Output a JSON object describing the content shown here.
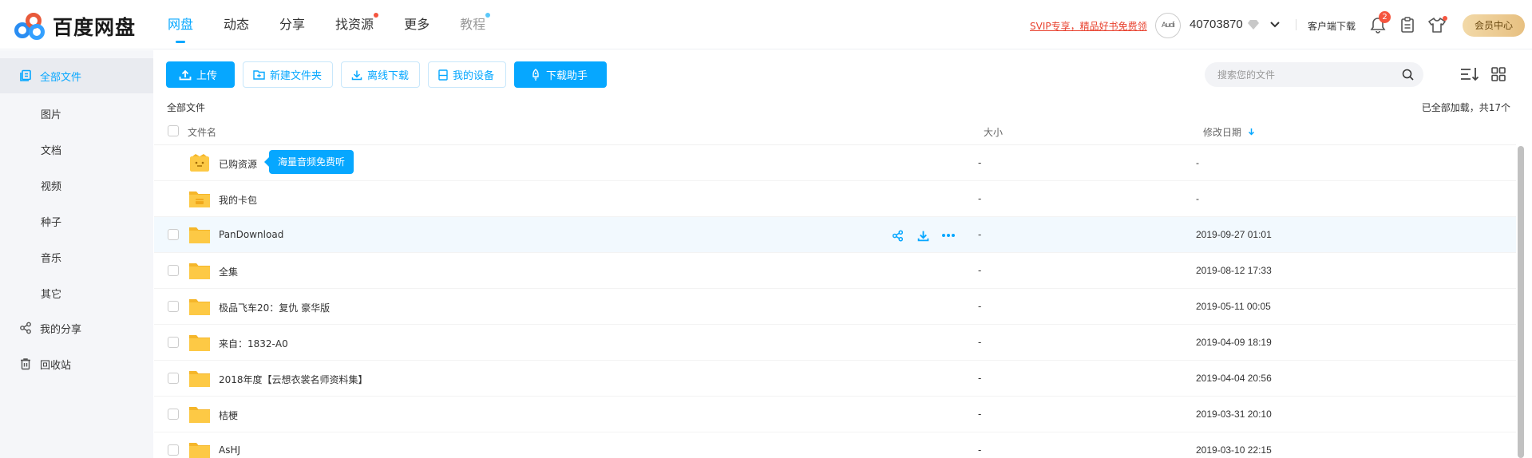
{
  "brand": {
    "name": "百度网盘"
  },
  "nav": [
    {
      "label": "网盘",
      "active": true,
      "dot": ""
    },
    {
      "label": "动态",
      "active": false,
      "dot": ""
    },
    {
      "label": "分享",
      "active": false,
      "dot": ""
    },
    {
      "label": "找资源",
      "active": false,
      "dot": "red"
    },
    {
      "label": "更多",
      "active": false,
      "dot": ""
    },
    {
      "label": "教程",
      "active": false,
      "dot": "blue"
    }
  ],
  "header": {
    "svip_promo": "SVIP专享，精品好书免费领",
    "avatar_text": "Audi",
    "username": "40703870",
    "client_download": "客户端下载",
    "notification_count": "2",
    "vip_center": "会员中心"
  },
  "sidebar": {
    "all_files": "全部文件",
    "categories": [
      "图片",
      "文档",
      "视频",
      "种子",
      "音乐",
      "其它"
    ],
    "my_share": "我的分享",
    "recycle": "回收站"
  },
  "toolbar": {
    "upload": "上传",
    "new_folder": "新建文件夹",
    "offline_download": "离线下载",
    "my_devices": "我的设备",
    "download_helper": "下载助手"
  },
  "search": {
    "placeholder": "搜索您的文件"
  },
  "breadcrumb": "全部文件",
  "loaded_info": "已全部加载，共17个",
  "table": {
    "col_name": "文件名",
    "col_size": "大小",
    "col_date": "修改日期",
    "rows": [
      {
        "name": "已购资源",
        "size": "-",
        "date": "-",
        "icon": "purchased-folder-icon"
      },
      {
        "name": "我的卡包",
        "size": "-",
        "date": "-",
        "icon": "card-folder-icon"
      },
      {
        "name": "PanDownload",
        "size": "-",
        "date": "2019-09-27 01:01",
        "icon": "folder-icon"
      },
      {
        "name": "全集",
        "size": "-",
        "date": "2019-08-12 17:33",
        "icon": "folder-icon"
      },
      {
        "name": "极品飞车20：复仇 豪华版",
        "size": "-",
        "date": "2019-05-11 00:05",
        "icon": "folder-icon"
      },
      {
        "name": "来自：1832-A0",
        "size": "-",
        "date": "2019-04-09 18:19",
        "icon": "folder-icon"
      },
      {
        "name": "2018年度【云想衣裳名师资料集】",
        "size": "-",
        "date": "2019-04-04 20:56",
        "icon": "folder-icon"
      },
      {
        "name": "桔梗",
        "size": "-",
        "date": "2019-03-31 20:10",
        "icon": "folder-icon"
      },
      {
        "name": "AsHJ",
        "size": "-",
        "date": "2019-03-10 22:15",
        "icon": "folder-icon"
      }
    ]
  },
  "tooltip": "海量音频免费听",
  "colors": {
    "accent": "#06a7ff",
    "promo": "#e8412e",
    "folder": "#fdc945",
    "badge": "#f5553f"
  }
}
